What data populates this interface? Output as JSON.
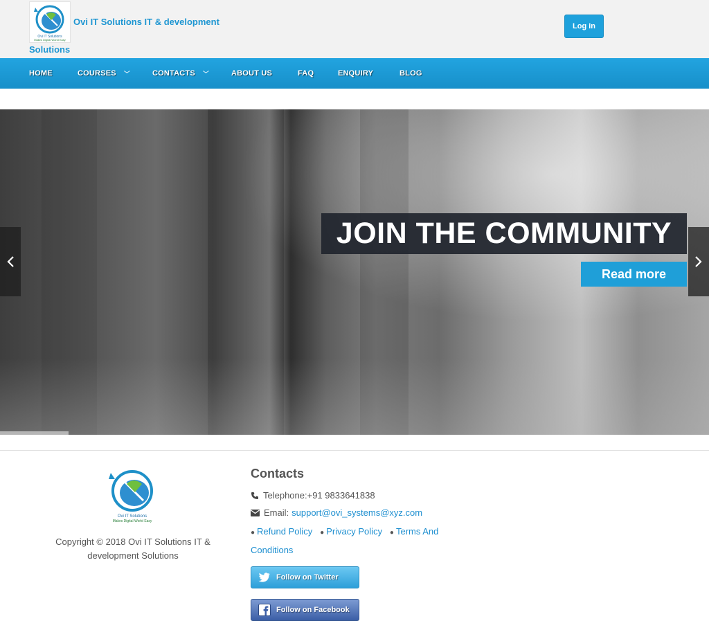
{
  "header": {
    "site_title_line1": "Ovi IT Solutions IT & development",
    "site_title_line2": "Solutions",
    "login_label": "Log in",
    "logo_text_1": "Ovi IT Solutions",
    "logo_text_2": "Makes Digital World Easy"
  },
  "nav": {
    "items": [
      {
        "label": "HOME"
      },
      {
        "label": "COURSES",
        "has_submenu": true
      },
      {
        "label": "CONTACTS",
        "has_submenu": true
      },
      {
        "label": "ABOUT US"
      },
      {
        "label": "FAQ"
      },
      {
        "label": "ENQUIRY"
      },
      {
        "label": "BLOG"
      }
    ],
    "caret": "﹀"
  },
  "slider": {
    "caption": "JOIN THE COMMUNITY",
    "button_label": "Read more",
    "prev_icon": "chevron-left-icon",
    "next_icon": "chevron-right-icon"
  },
  "footer": {
    "copyright": "Copyright © 2018 Ovi IT Solutions IT & development Solutions",
    "contacts_title": "Contacts",
    "telephone": "Telephone:+91 9833641838",
    "email_label": "Email:",
    "email": "support@ovi_systems@xyz.com",
    "policies": [
      {
        "label": "Refund Policy"
      },
      {
        "label": "Privacy Policy"
      },
      {
        "label": "Terms And Conditions"
      }
    ],
    "twitter_label": "Follow on Twitter",
    "facebook_label": "Follow on Facebook"
  },
  "colors": {
    "accent": "#1ea1dc",
    "nav_bg": "#1b9bd8",
    "caption_bg": "#21252e",
    "link": "#1e8fd0"
  }
}
